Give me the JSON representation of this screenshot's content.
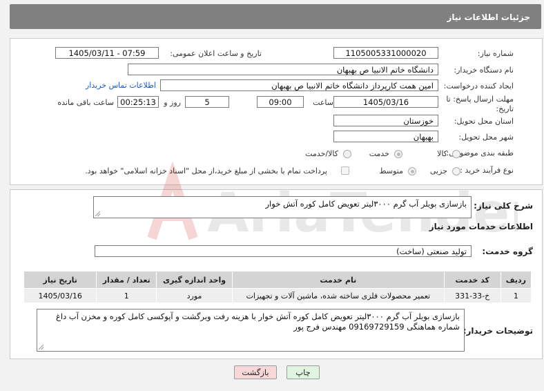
{
  "header": {
    "title": "جزئیات اطلاعات نیاز"
  },
  "form": {
    "need_number_label": "شماره نیاز:",
    "need_number": "1105005331000020",
    "announce_label": "تاریخ و ساعت اعلان عمومی:",
    "announce_value": "1405/03/11 - 07:59",
    "buyer_org_label": "نام دستگاه خریدار:",
    "buyer_org": "دانشگاه خاتم الانبیا  ص  بهبهان",
    "requester_label": "ایجاد کننده درخواست:",
    "requester": "امین همت کارپرداز دانشگاه خاتم الانبیا  ص  بهبهان",
    "buyer_contact_link": "اطلاعات تماس خریدار",
    "deadline_label_1": "مهلت ارسال پاسخ: تا",
    "deadline_label_2": "تاریخ:",
    "deadline_date": "1405/03/16",
    "time_label": "ساعت",
    "deadline_time": "09:00",
    "days_value": "5",
    "days_label": "روز و",
    "remaining_time": "00:25:13",
    "remaining_label": "ساعت باقی مانده",
    "province_label": "استان محل تحویل:",
    "province": "خوزستان",
    "city_label": "شهر محل تحویل:",
    "city": "بهبهان",
    "category_label": "طبقه بندی موضوعی:",
    "category_options": [
      "کالا",
      "خدمت",
      "کالا/خدمت"
    ],
    "category_selected": "خدمت",
    "process_label": "نوع فرآیند خرید :",
    "process_options": [
      "جزیی",
      "متوسط"
    ],
    "process_selected": "متوسط",
    "treasury_text": "پرداخت تمام یا بخشی از مبلغ خرید،از محل \"اسناد خزانه اسلامی\" خواهد بود."
  },
  "summary": {
    "label": "شرح کلی نیاز:",
    "text": "بازسازی بویلر آب گرم ۳۰۰۰لیتر تعویض کامل کوره آتش خوار"
  },
  "services": {
    "section_title": "اطلاعات خدمات مورد نیاز",
    "group_label": "گروه خدمت:",
    "group_value": "تولید صنعتی (ساخت)",
    "columns": [
      "ردیف",
      "کد خدمت",
      "نام خدمت",
      "واحد اندازه گیری",
      "تعداد / مقدار",
      "تاریخ نیاز"
    ],
    "rows": [
      [
        "1",
        "خ-33-331",
        "تعمیر محصولات فلزی ساخته شده، ماشین آلات و تجهیزات",
        "مورد",
        "1",
        "1405/03/16"
      ]
    ]
  },
  "buyer_notes": {
    "label": "توضیحات خریدار:",
    "text": "بازسازی بویلر آب گرم ۳۰۰۰لیتر تعویض کامل کوره آتش خوار با هزینه رفت وبرگشت و آپوکسی کامل کوره و مخزن آب داغ شماره هماهنگی 09169729159 مهندس فرج پور"
  },
  "buttons": {
    "print": "چاپ",
    "back": "بازگشت"
  },
  "watermark_text": "AriaTender.neT",
  "colors": {
    "titlebar": "#808080",
    "link": "#1a5bb5",
    "back_button": "#f7d7d7",
    "print_button": "#dff5df"
  }
}
